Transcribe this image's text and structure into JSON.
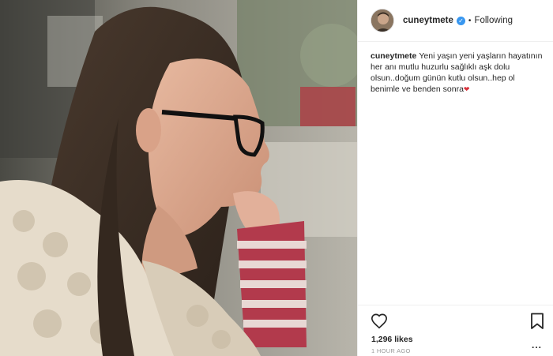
{
  "post": {
    "username": "cuneytmete",
    "verified": true,
    "follow_status": "Following",
    "separator": "•",
    "caption": "Yeni yaşın yeni yaşların hayatının her anı mutlu huzurlu sağlıklı aşk dolu olsun..doğum günün kutlu olsun..hep ol benimle ve benden sonra",
    "caption_emoji": "❤",
    "likes": "1,296 likes",
    "timestamp": "1 HOUR AGO",
    "more_options": "...",
    "verified_mark": "✓"
  },
  "icons": {
    "like": "heart-outline-icon",
    "save": "bookmark-icon",
    "verified": "verified-badge-icon"
  },
  "colors": {
    "verified": "#3897f0",
    "text": "#262626",
    "muted": "#999999",
    "border": "#efefef"
  }
}
